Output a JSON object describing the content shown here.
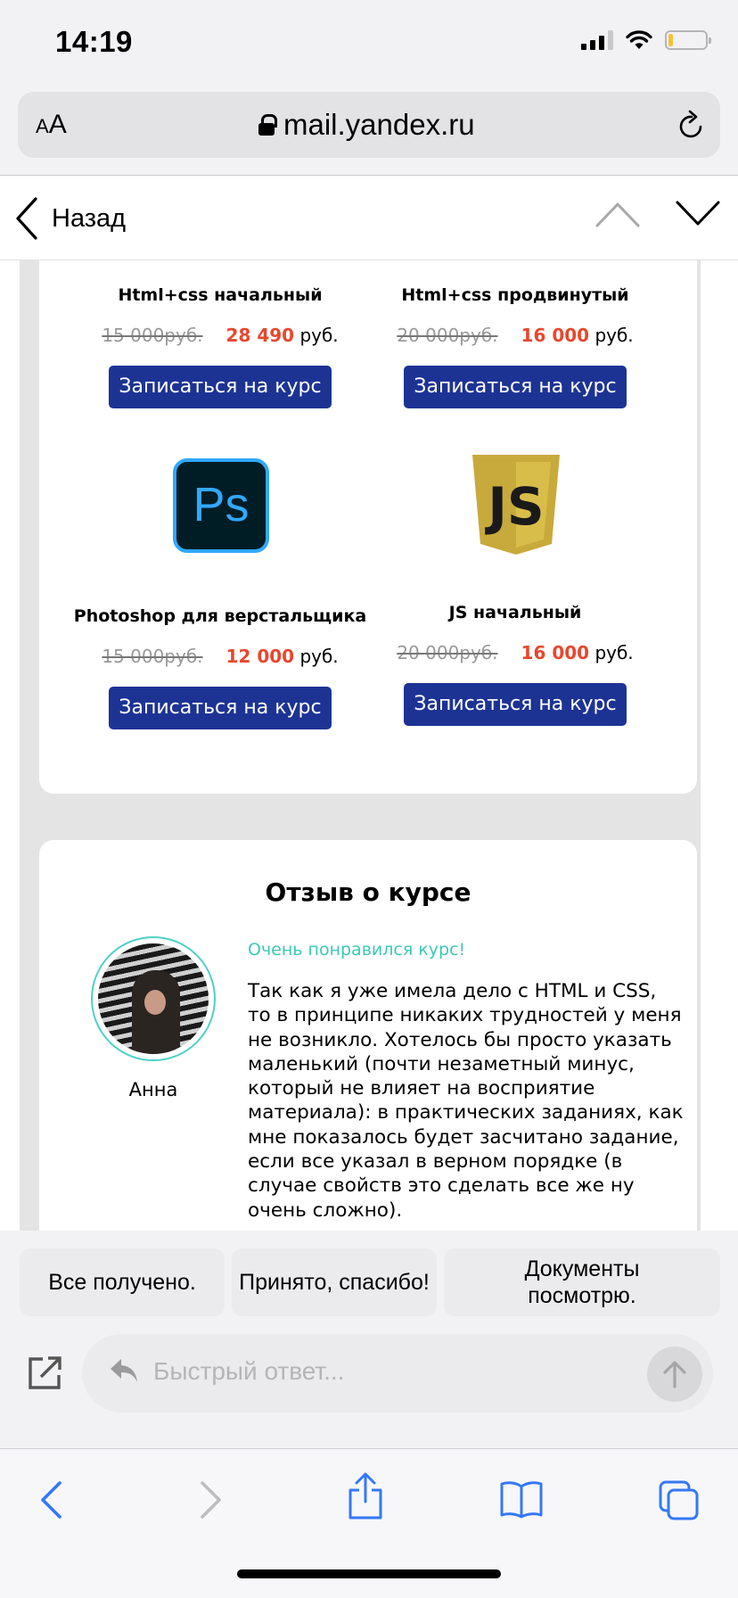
{
  "status": {
    "time": "14:19"
  },
  "browser": {
    "text_size_small": "A",
    "text_size_large": "A",
    "url": "mail.yandex.ru"
  },
  "nav": {
    "back_label": "Назад"
  },
  "courses": [
    {
      "title": "Html+css начальный",
      "old_price": "15 000руб.",
      "new_price": "28 490",
      "currency": "руб.",
      "button": "Записаться на курс"
    },
    {
      "title": "Html+css продвинутый",
      "old_price": "20 000руб.",
      "new_price": "16 000",
      "currency": "руб.",
      "button": "Записаться на курс"
    },
    {
      "title": "Photoshop для верстальщика",
      "old_price": "15 000руб.",
      "new_price": "12 000",
      "currency": "руб.",
      "button": "Записаться на курс",
      "icon": "photoshop-icon",
      "icon_text": "Ps"
    },
    {
      "title": "JS начальный",
      "old_price": "20 000руб.",
      "new_price": "16 000",
      "currency": "руб.",
      "button": "Записаться на курс",
      "icon": "javascript-icon",
      "icon_text": "JS"
    }
  ],
  "review": {
    "title": "Отзыв о курсе",
    "author": "Анна",
    "headline": "Очень понравился курс!",
    "body": "Так как я уже имела дело с HTML и CSS, то в принципе никаких трудностей у меня не возникло. Хотелось бы просто указать маленький (почти незаметный минус, который не влияет на восприятие материала): в практических заданиях, как мне показалось будет засчитано задание, если все указал в верном порядке (в случае свойств это сделать все же ну очень сложно)."
  },
  "quick_replies": [
    "Все получено.",
    "Принято, спасибо!",
    "Документы посмотрю."
  ],
  "reply": {
    "placeholder": "Быстрый ответ..."
  },
  "colors": {
    "accent_button": "#1d3394",
    "price_red": "#e8472e",
    "teal": "#3dc9b5",
    "safari_blue": "#3478f6"
  }
}
